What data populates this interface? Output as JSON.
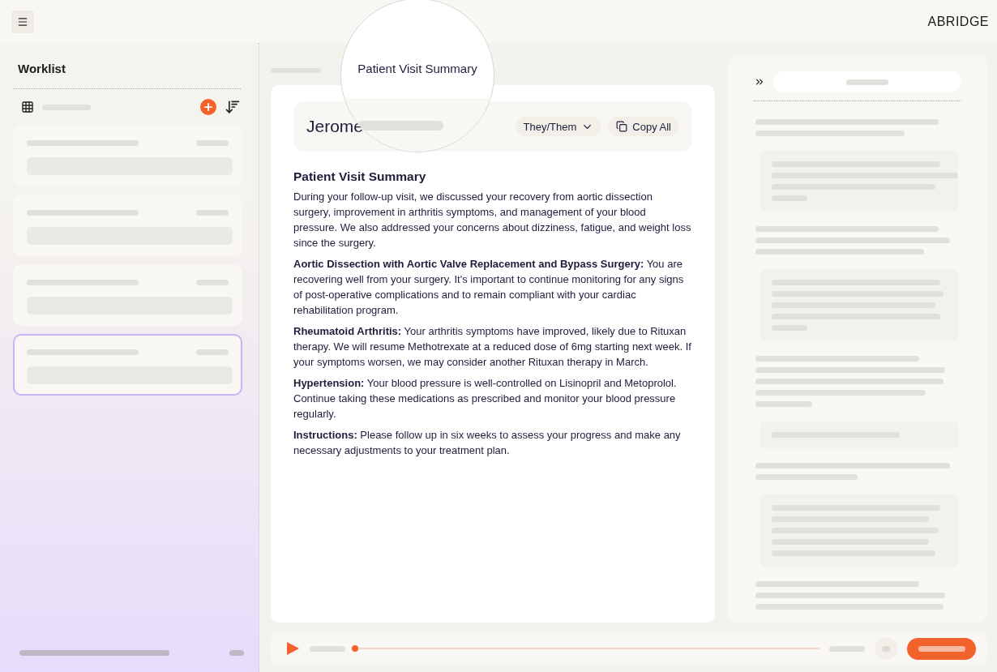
{
  "header": {
    "logo": "ABRIDGE"
  },
  "sidebar": {
    "title": "Worklist",
    "items": [
      {
        "selected": false
      },
      {
        "selected": false
      },
      {
        "selected": false
      },
      {
        "selected": true
      }
    ]
  },
  "magnifier": {
    "tab_label": "Patient Visit Summary"
  },
  "document": {
    "patient_name": "Jerome",
    "pronouns": "They/Them",
    "copy_button": "Copy All",
    "heading": "Patient Visit Summary",
    "paragraphs": [
      "During your follow-up visit, we discussed your recovery from aortic dissection surgery, improvement in arthritis symptoms, and management of your blood pressure. We also addressed your concerns about dizziness, fatigue, and weight loss since the surgery.",
      "**Aortic Dissection with Aortic Valve Replacement and Bypass Surgery:** You are recovering well from your surgery. It's important to continue monitoring for any signs of post-operative complications and to remain compliant with your cardiac rehabilitation program.",
      "**Rheumatoid Arthritis:** Your arthritis symptoms have improved, likely due to Rituxan therapy. We will resume Methotrexate at a reduced dose of 6mg starting next week. If your symptoms worsen, we may consider another Rituxan therapy in March.",
      "**Hypertension:** Your blood pressure is well-controlled on Lisinopril and Metoprolol. Continue taking these medications as prescribed and monitor your blood pressure regularly.",
      "**Instructions:** Please follow up in six weeks to assess your progress and make any necessary adjustments to your treatment plan."
    ]
  },
  "player": {
    "level": 0
  }
}
